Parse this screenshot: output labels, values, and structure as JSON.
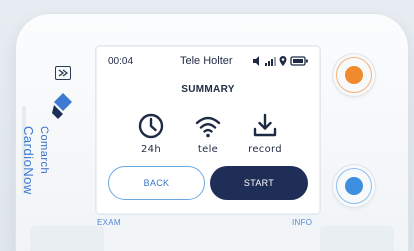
{
  "status_bar": {
    "time": "00:04",
    "title": "Tele Holter"
  },
  "summary": {
    "heading": "SUMMARY"
  },
  "features": [
    {
      "label": "24h",
      "icon": "clock-icon"
    },
    {
      "label": "tele",
      "icon": "wifi-icon"
    },
    {
      "label": "record",
      "icon": "download-icon"
    }
  ],
  "buttons": {
    "back": "BACK",
    "start": "START"
  },
  "under_screen": {
    "left": "EXAM",
    "right": "INFO"
  },
  "brand": {
    "line1": "Comarch",
    "line2": "CardioNow"
  },
  "colors": {
    "navy": "#1f2e57",
    "accent_blue": "#3a74c4",
    "orange_button": "#f08a2c",
    "blue_button": "#3f8fe0"
  }
}
